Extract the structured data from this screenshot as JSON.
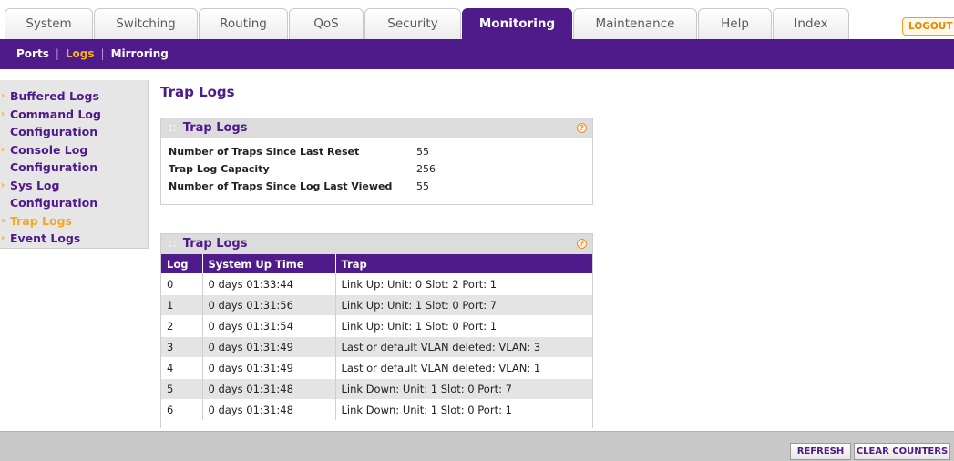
{
  "tabs": [
    {
      "label": "System"
    },
    {
      "label": "Switching"
    },
    {
      "label": "Routing"
    },
    {
      "label": "QoS"
    },
    {
      "label": "Security"
    },
    {
      "label": "Monitoring"
    },
    {
      "label": "Maintenance"
    },
    {
      "label": "Help"
    },
    {
      "label": "Index"
    }
  ],
  "logout_label": "LOGOUT",
  "subnav": {
    "items": [
      {
        "label": "Ports"
      },
      {
        "label": "Logs"
      },
      {
        "label": "Mirroring"
      }
    ],
    "separator": "|"
  },
  "sidebar": {
    "items": [
      {
        "label": "Buffered Logs"
      },
      {
        "label": "Command Log"
      },
      {
        "label": "Configuration"
      },
      {
        "label": "Console Log"
      },
      {
        "label": "Configuration"
      },
      {
        "label": "Sys Log"
      },
      {
        "label": "Configuration"
      },
      {
        "label": "Trap Logs"
      },
      {
        "label": "Event Logs"
      }
    ],
    "marker": "›",
    "active_marker": "»"
  },
  "page_title": "Trap Logs",
  "summary_panel": {
    "title": "Trap Logs",
    "dots": "::",
    "help": "?",
    "rows": [
      {
        "label": "Number of Traps Since Last Reset",
        "value": "55"
      },
      {
        "label": "Trap Log Capacity",
        "value": "256"
      },
      {
        "label": "Number of Traps Since Log Last Viewed",
        "value": "55"
      }
    ]
  },
  "logs_panel": {
    "title": "Trap Logs",
    "dots": "::",
    "help": "?",
    "columns": [
      "Log",
      "System Up Time",
      "Trap"
    ],
    "rows": [
      {
        "log": "0",
        "time": "0 days 01:33:44",
        "trap": "Link Up: Unit: 0 Slot: 2 Port: 1"
      },
      {
        "log": "1",
        "time": "0 days 01:31:56",
        "trap": "Link Up: Unit: 1 Slot: 0 Port: 7"
      },
      {
        "log": "2",
        "time": "0 days 01:31:54",
        "trap": "Link Up: Unit: 1 Slot: 0 Port: 1"
      },
      {
        "log": "3",
        "time": "0 days 01:31:49",
        "trap": "Last or default VLAN deleted: VLAN: 3"
      },
      {
        "log": "4",
        "time": "0 days 01:31:49",
        "trap": "Last or default VLAN deleted: VLAN: 1"
      },
      {
        "log": "5",
        "time": "0 days 01:31:48",
        "trap": "Link Down: Unit: 1 Slot: 0 Port: 7"
      },
      {
        "log": "6",
        "time": "0 days 01:31:48",
        "trap": "Link Down: Unit: 1 Slot: 0 Port: 1"
      }
    ]
  },
  "buttons": {
    "refresh": "REFRESH",
    "clear": "CLEAR COUNTERS"
  },
  "colors": {
    "brand_purple": "#4f1a8a",
    "accent_orange": "#f5a623"
  }
}
